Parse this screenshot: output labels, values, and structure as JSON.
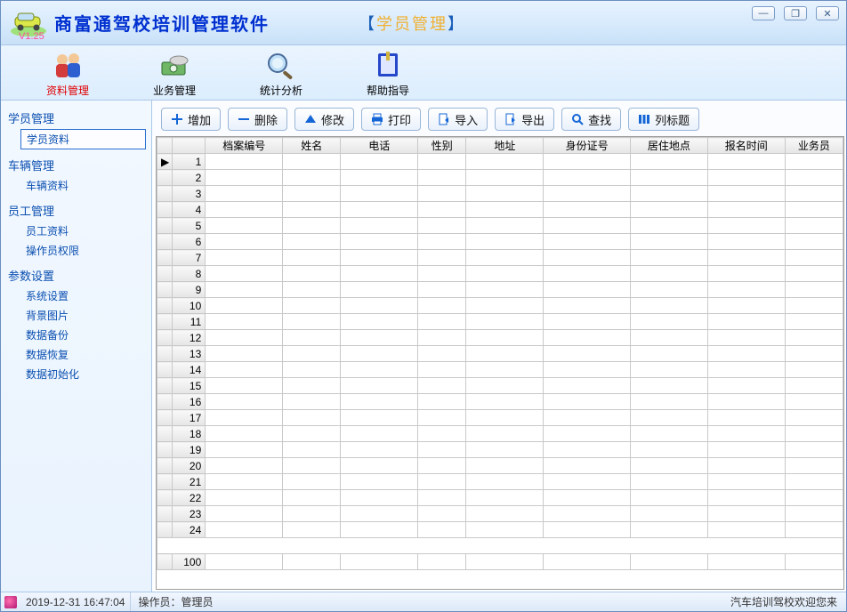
{
  "title": "商富通驾校培训管理软件",
  "version": "V1.25",
  "section_label": "学员管理",
  "window_buttons": {
    "min": "—",
    "max": "❐",
    "close": "✕"
  },
  "main_tabs": [
    {
      "label": "资料管理",
      "icon": "people-icon",
      "active": true
    },
    {
      "label": "业务管理",
      "icon": "money-icon",
      "active": false
    },
    {
      "label": "统计分析",
      "icon": "magnifier-icon",
      "active": false
    },
    {
      "label": "帮助指导",
      "icon": "book-icon",
      "active": false
    }
  ],
  "sidebar": [
    {
      "title": "学员管理",
      "items": [
        {
          "label": "学员资料",
          "selected": true
        }
      ]
    },
    {
      "title": "车辆管理",
      "items": [
        {
          "label": "车辆资料"
        }
      ]
    },
    {
      "title": "员工管理",
      "items": [
        {
          "label": "员工资料"
        },
        {
          "label": "操作员权限"
        }
      ]
    },
    {
      "title": "参数设置",
      "items": [
        {
          "label": "系统设置"
        },
        {
          "label": "背景图片"
        },
        {
          "label": "数据备份"
        },
        {
          "label": "数据恢复"
        },
        {
          "label": "数据初始化"
        }
      ]
    }
  ],
  "actions": [
    {
      "label": "增加",
      "icon": "plus",
      "color": "#1466d6"
    },
    {
      "label": "删除",
      "icon": "minus",
      "color": "#1466d6"
    },
    {
      "label": "修改",
      "icon": "triangle-up",
      "color": "#1466d6"
    },
    {
      "label": "打印",
      "icon": "printer",
      "color": "#1466d6"
    },
    {
      "label": "导入",
      "icon": "doc-in",
      "color": "#1466d6"
    },
    {
      "label": "导出",
      "icon": "doc-out",
      "color": "#1466d6"
    },
    {
      "label": "查找",
      "icon": "search",
      "color": "#1466d6"
    },
    {
      "label": "列标题",
      "icon": "columns",
      "color": "#1466d6"
    }
  ],
  "grid": {
    "columns": [
      "档案编号",
      "姓名",
      "电话",
      "性别",
      "地址",
      "身份证号",
      "居住地点",
      "报名时间",
      "业务员"
    ],
    "visible_rows": 24,
    "total_rows": 100
  },
  "status": {
    "datetime": "2019-12-31 16:47:04",
    "operator_label": "操作员：",
    "operator_value": "管理员",
    "marquee": "汽车培训驾校欢迎您来"
  },
  "colors": {
    "link": "#0a4fb0",
    "active": "#e00000",
    "accent": "#1466d6"
  }
}
